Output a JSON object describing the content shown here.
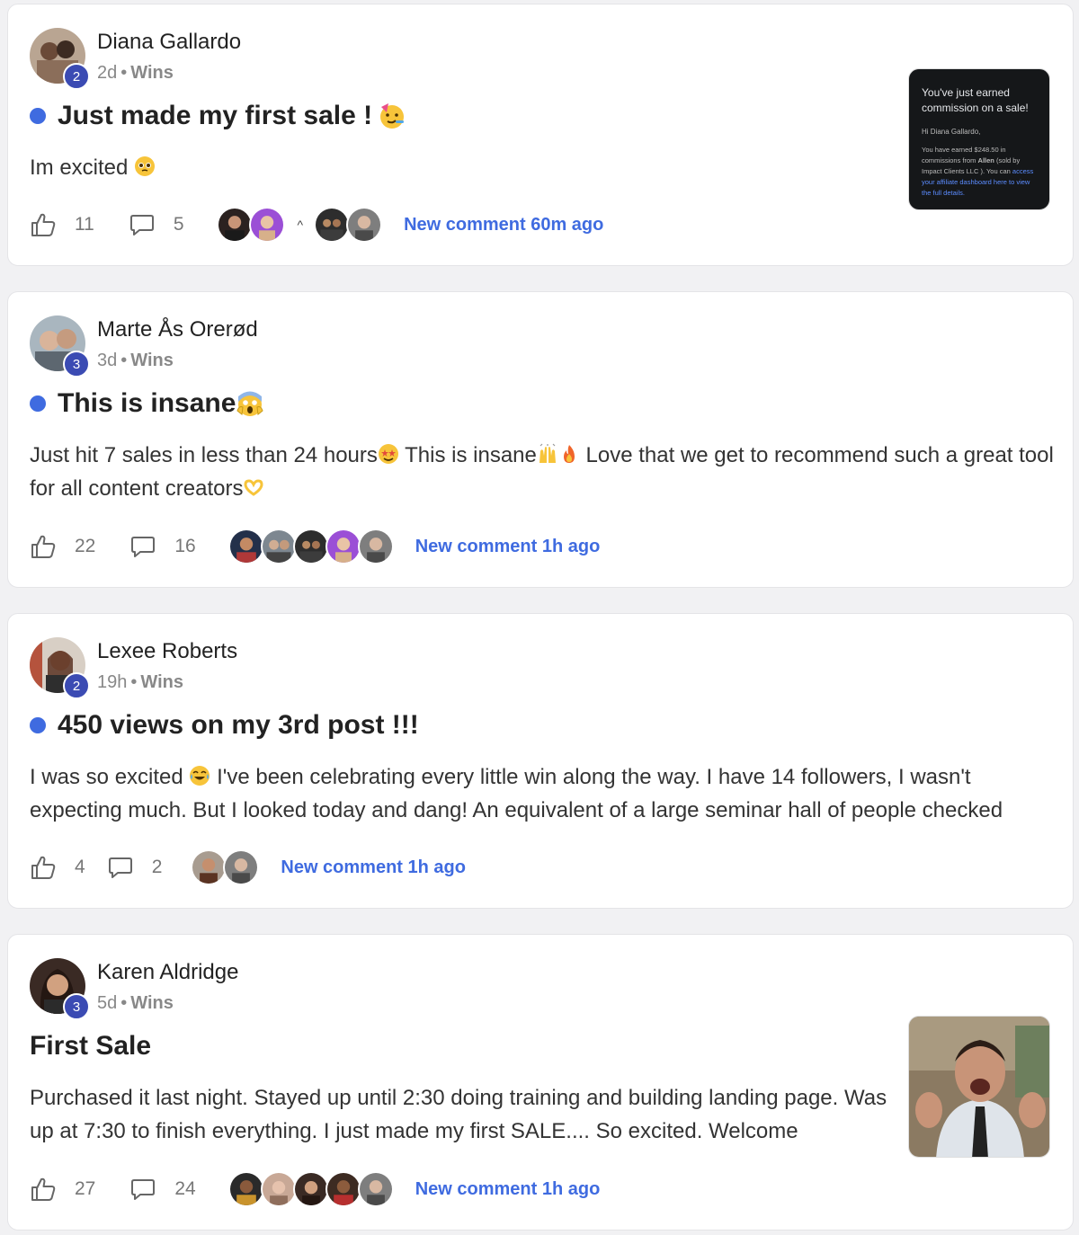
{
  "posts": [
    {
      "author": "Diana Gallardo",
      "level": "2",
      "time": "2d",
      "category": "Wins",
      "title": "Just made my first sale !",
      "title_emoji": "partying-face",
      "body": "Im excited",
      "body_emoji": "pleading-face",
      "likes": "11",
      "comments": "5",
      "new_comment": "New comment 60m ago",
      "attachment": {
        "type": "email-screenshot",
        "heading": "You've just earned commission on a sale!",
        "greeting": "Hi Diana Gallardo,",
        "text_1": "You have earned $248.50 in commissions from",
        "text_brand": "Allen",
        "text_2": "(sold by Impact Clients LLC ). You can",
        "link": "access your affiliate dashboard here to view the full details."
      }
    },
    {
      "author": "Marte Ås Orerød",
      "level": "3",
      "time": "3d",
      "category": "Wins",
      "title": "This is insane",
      "title_emoji": "screaming-face",
      "body_1": "Just hit 7 sales in less than 24 hours",
      "body_2": " This is insane",
      "body_3": " Love that we get to recommend such a great tool for all content creators",
      "likes": "22",
      "comments": "16",
      "new_comment": "New comment 1h ago"
    },
    {
      "author": "Lexee Roberts",
      "level": "2",
      "time": "19h",
      "category": "Wins",
      "title": "450 views on my 3rd post !!!",
      "body_1": "I was so excited",
      "body_2": " I've been celebrating every little win along the way. I have 14 followers, I wasn't expecting much. But I looked today and dang! An equivalent of a large seminar hall of people checked",
      "likes": "4",
      "comments": "2",
      "new_comment": "New comment 1h ago"
    },
    {
      "author": "Karen Aldridge",
      "level": "3",
      "time": "5d",
      "category": "Wins",
      "title": "First Sale",
      "body": "Purchased it last night. Stayed up until 2:30 doing training and building landing page. Was up at 7:30 to finish everything. I just made my first SALE.... So excited. Welcome",
      "likes": "27",
      "comments": "24",
      "new_comment": "New comment 1h ago",
      "attachment": {
        "type": "image",
        "subject": "excited-man-clapping"
      }
    }
  ],
  "colors": {
    "accent": "#3f6be0",
    "level_badge": "#3b4bb3",
    "muted": "#888888"
  },
  "icons": {
    "like": "thumbs-up-icon",
    "comment": "speech-bubble-icon",
    "caret": "caret-up-icon"
  }
}
